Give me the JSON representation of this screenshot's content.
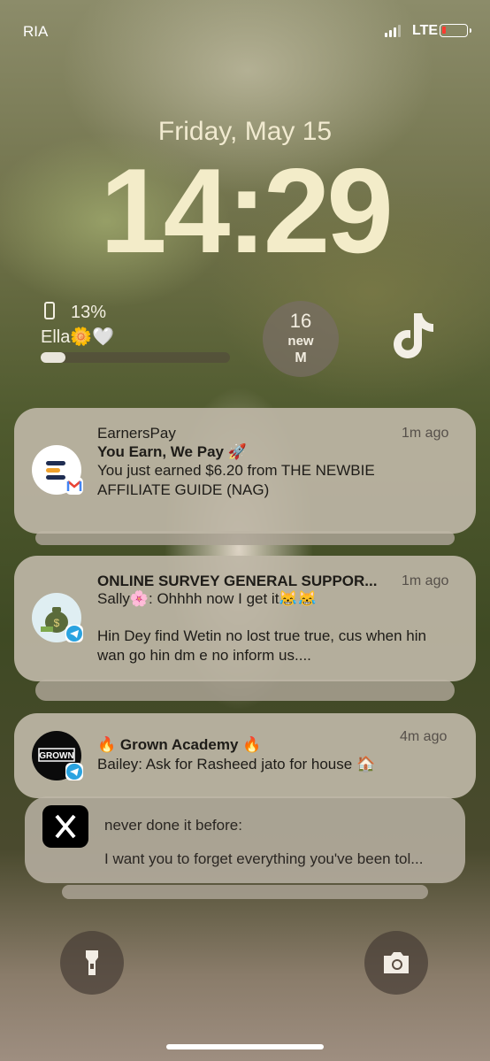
{
  "status_bar": {
    "carrier": "RIA",
    "network": "LTE"
  },
  "lockscreen": {
    "date": "Friday, May 15",
    "time": "14:29"
  },
  "battery_widget": {
    "percent": "13%",
    "device": "Ella🌼🤍",
    "level": 0.13
  },
  "mail_widget": {
    "count": "16",
    "label": "new",
    "icon": "M"
  },
  "tiktok_widget": {
    "icon": "tiktok-icon"
  },
  "notifications": [
    {
      "app": "EarnersPay",
      "title": "You Earn, We Pay 🚀",
      "body": "You just earned $6.20 from THE NEWBIE AFFILIATE GUIDE (NAG)",
      "time": "1m ago",
      "badge": "gmail-icon"
    },
    {
      "app": "ONLINE SURVEY GENERAL SUPPOR...",
      "title": "Sally🌸: Ohhhh now I get it😹😹",
      "body": "Hin Dey find Wetin no lost true true, cus when hin wan go hin dm e no inform us....",
      "time": "1m ago",
      "badge": "telegram-icon"
    },
    {
      "app": "🔥 Grown Academy 🔥",
      "title": "Bailey: Ask for Rasheed jato for house 🏠",
      "time": "4m ago",
      "badge": "telegram-icon",
      "logo_text": "GROWN"
    },
    {
      "body_line1": "never done it before:",
      "body_line2": "I want you to forget everything you've been tol...",
      "icon": "x-icon"
    }
  ],
  "bottom": {
    "left": "flashlight-icon",
    "right": "camera-icon"
  },
  "colors": {
    "time": "#f3ecc9",
    "card": "#beb6a6",
    "gmail_red": "#ea4335",
    "telegram_blue": "#2aa3e0"
  }
}
